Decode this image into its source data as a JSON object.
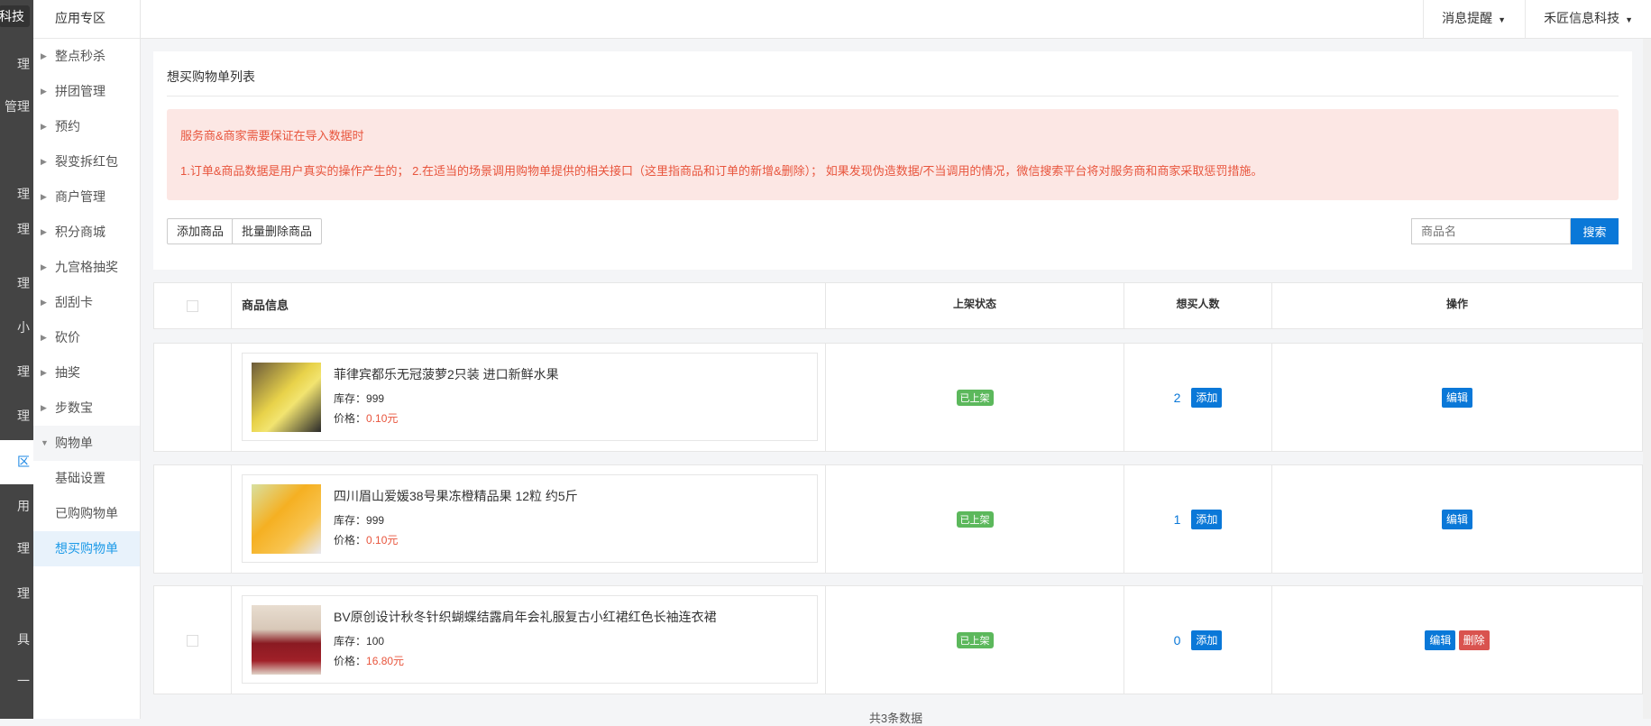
{
  "dark_sidebar": {
    "items": [
      "科技",
      "理",
      "管理",
      "理",
      "理",
      "理",
      "小",
      "理",
      "理",
      "区",
      "用",
      "理",
      "理",
      "具",
      "一"
    ]
  },
  "submenu": {
    "title": "应用专区",
    "items": [
      {
        "label": "整点秒杀"
      },
      {
        "label": "拼团管理"
      },
      {
        "label": "预约"
      },
      {
        "label": "裂变拆红包"
      },
      {
        "label": "商户管理"
      },
      {
        "label": "积分商城"
      },
      {
        "label": "九宫格抽奖"
      },
      {
        "label": "刮刮卡"
      },
      {
        "label": "砍价"
      },
      {
        "label": "抽奖"
      },
      {
        "label": "步数宝"
      },
      {
        "label": "购物单"
      }
    ],
    "children": [
      "基础设置",
      "已购购物单",
      "想买购物单"
    ]
  },
  "header": {
    "messages": "消息提醒",
    "account": "禾匠信息科技"
  },
  "card": {
    "title": "想买购物单列表",
    "alert_line1": "服务商&商家需要保证在导入数据时",
    "alert_line2": "1.订单&商品数据是用户真实的操作产生的； 2.在适当的场景调用购物单提供的相关接口（这里指商品和订单的新增&删除）； 如果发现伪造数据/不当调用的情况，微信搜索平台将对服务商和商家采取惩罚措施。",
    "add_button": "添加商品",
    "batch_delete_button": "批量删除商品",
    "search_placeholder": "商品名",
    "search_button": "搜索"
  },
  "table": {
    "headers": [
      "商品信息",
      "上架状态",
      "想买人数",
      "操作"
    ],
    "rows": [
      {
        "name": "菲律宾都乐无冠菠萝2只装 进口新鲜水果",
        "stock_label": "库存：",
        "stock": "999",
        "price_label": "价格：",
        "price": "0.10元",
        "status": "已上架",
        "count": "2",
        "add": "添加",
        "edit": "编辑"
      },
      {
        "name": "四川眉山爱媛38号果冻橙精品果 12粒 约5斤",
        "stock_label": "库存：",
        "stock": "999",
        "price_label": "价格：",
        "price": "0.10元",
        "status": "已上架",
        "count": "1",
        "add": "添加",
        "edit": "编辑"
      },
      {
        "name": "BV原创设计秋冬针织蝴蝶结露肩年会礼服复古小红裙红色长袖连衣裙",
        "stock_label": "库存：",
        "stock": "100",
        "price_label": "价格：",
        "price": "16.80元",
        "status": "已上架",
        "count": "0",
        "add": "添加",
        "edit": "编辑",
        "delete": "删除"
      }
    ]
  },
  "footer": "共3条数据",
  "colors": {
    "primary": "#0a78d8",
    "success": "#5cb85c",
    "danger": "#d9534f",
    "alert_bg": "#fce7e4",
    "alert_text": "#e8553d"
  }
}
